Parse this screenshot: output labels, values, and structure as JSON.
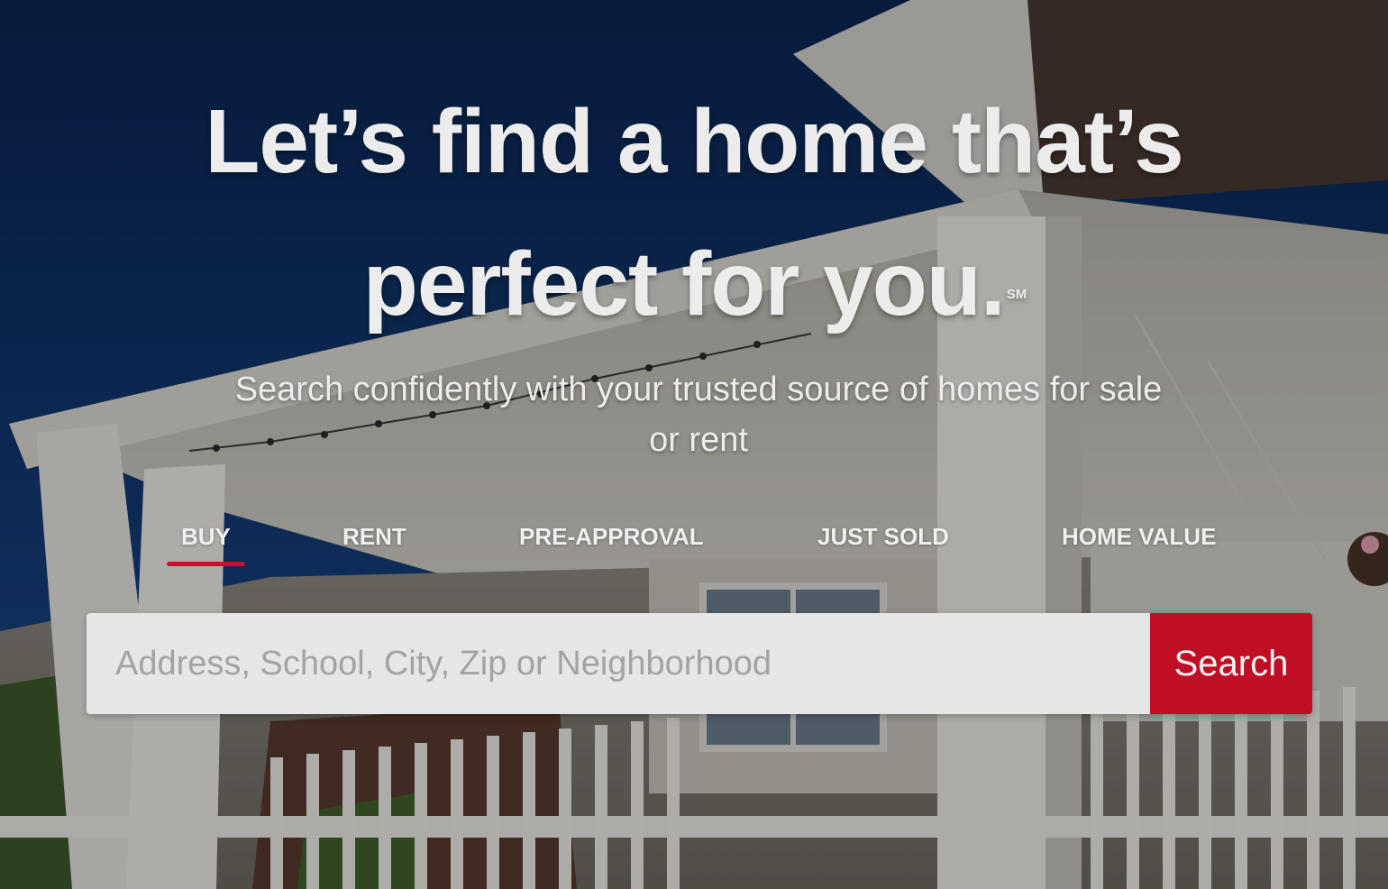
{
  "hero": {
    "headline_line1": "Let’s find a home that’s",
    "headline_line2": "perfect for you.",
    "service_mark": "SM",
    "subtitle": "Search confidently with your trusted source of homes for sale or rent"
  },
  "tabs": [
    {
      "label": "BUY",
      "active": true
    },
    {
      "label": "RENT",
      "active": false
    },
    {
      "label": "PRE-APPROVAL",
      "active": false
    },
    {
      "label": "JUST SOLD",
      "active": false
    },
    {
      "label": "HOME VALUE",
      "active": false
    }
  ],
  "search": {
    "placeholder": "Address, School, City, Zip or Neighborhood",
    "value": "",
    "button_label": "Search"
  },
  "colors": {
    "accent": "#c00f24",
    "sky": "#0b2a57",
    "text": "#ececec"
  }
}
